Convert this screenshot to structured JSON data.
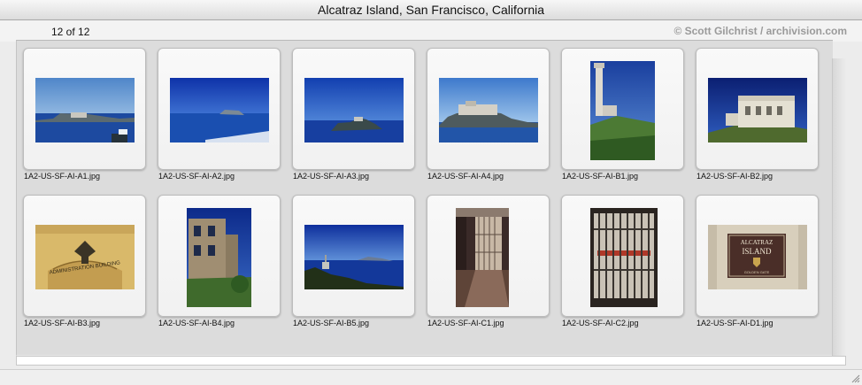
{
  "window": {
    "title": "Alcatraz Island, San Francisco, California"
  },
  "header": {
    "count": "12 of 12",
    "credit": "© Scott Gilchrist / archivision.com"
  },
  "thumbnails": [
    {
      "file": "1A2-US-SF-AI-A1.jpg",
      "subject": "island from water"
    },
    {
      "file": "1A2-US-SF-AI-A2.jpg",
      "subject": "island distant wake"
    },
    {
      "file": "1A2-US-SF-AI-A3.jpg",
      "subject": "island distant"
    },
    {
      "file": "1A2-US-SF-AI-A4.jpg",
      "subject": "island close"
    },
    {
      "file": "1A2-US-SF-AI-B1.jpg",
      "subject": "lighthouse"
    },
    {
      "file": "1A2-US-SF-AI-B2.jpg",
      "subject": "building on hill"
    },
    {
      "file": "1A2-US-SF-AI-B3.jpg",
      "subject": "administration building sign"
    },
    {
      "file": "1A2-US-SF-AI-B4.jpg",
      "subject": "ruined building"
    },
    {
      "file": "1A2-US-SF-AI-B5.jpg",
      "subject": "bay view"
    },
    {
      "file": "1A2-US-SF-AI-C1.jpg",
      "subject": "cell block"
    },
    {
      "file": "1A2-US-SF-AI-C2.jpg",
      "subject": "cell bars"
    },
    {
      "file": "1A2-US-SF-AI-D1.jpg",
      "subject": "alcatraz island sign"
    }
  ],
  "sign_texts": {
    "admin": "ADMINISTRATION BUILDING",
    "line1": "ALCATRAZ",
    "line2": "ISLAND",
    "line3": "GOLDEN GATE"
  }
}
